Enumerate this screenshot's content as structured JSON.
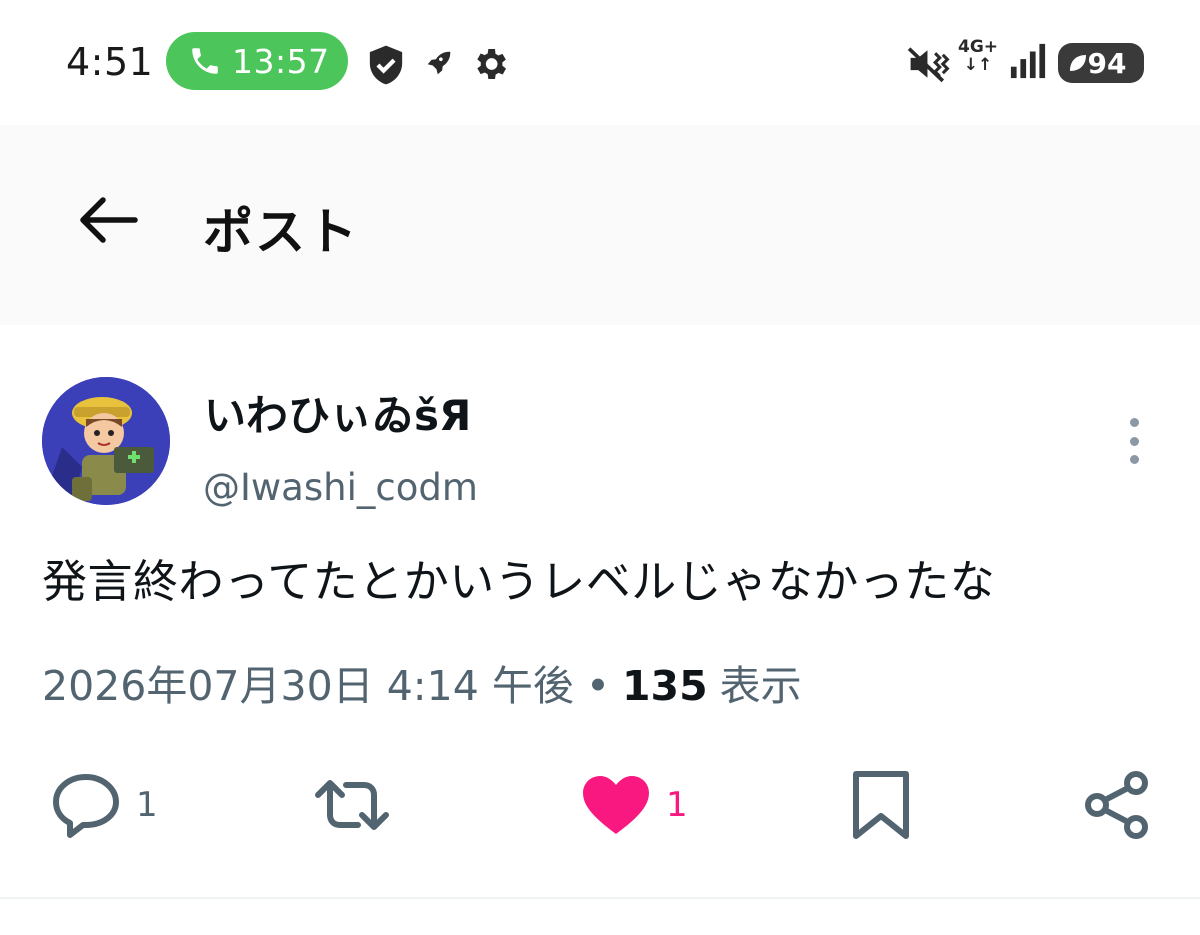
{
  "status_bar": {
    "time": "4:51",
    "call_timer": "13:57",
    "network": "4G+",
    "battery": "94",
    "icons": [
      "phone-icon",
      "shield-check-icon",
      "rocket-icon",
      "gear-icon",
      "vibrate-icon",
      "signal-icon",
      "battery-icon"
    ]
  },
  "header": {
    "title": "ポスト",
    "back_icon": "arrow-left-icon"
  },
  "post": {
    "display_name": "いわひぃゐšЯ",
    "handle": "@Iwashi_codm",
    "text": "発言終わってたとかいうレベルじゃなかったな",
    "timestamp": "2026年07月30日 4:14 午後",
    "separator": "•",
    "view_count": "135",
    "view_label": "表示"
  },
  "actions": {
    "reply_count": "1",
    "retweet_count": "",
    "like_count": "1",
    "like_color": "#f91880",
    "icon_color": "#536471"
  }
}
